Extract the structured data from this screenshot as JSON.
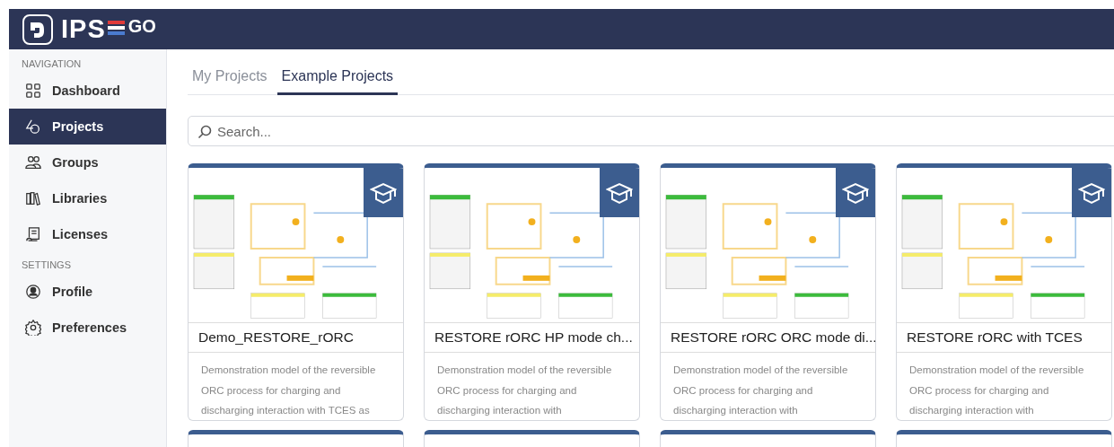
{
  "app": {
    "logo_text": "IPS",
    "logo_suffix": "GO"
  },
  "sidebar": {
    "sections": [
      {
        "heading": "NAVIGATION",
        "items": [
          {
            "label": "Dashboard",
            "kind": "grid",
            "selected": false
          },
          {
            "label": "Projects",
            "kind": "shapes",
            "selected": true
          },
          {
            "label": "Groups",
            "kind": "users",
            "selected": false
          },
          {
            "label": "Libraries",
            "kind": "books",
            "selected": false
          },
          {
            "label": "Licenses",
            "kind": "scroll",
            "selected": false
          }
        ]
      },
      {
        "heading": "SETTINGS",
        "items": [
          {
            "label": "Profile",
            "kind": "profile",
            "selected": false
          },
          {
            "label": "Preferences",
            "kind": "gear",
            "selected": false
          }
        ]
      }
    ]
  },
  "tabs": [
    {
      "label": "My Projects",
      "selected": false
    },
    {
      "label": "Example Projects",
      "selected": true
    }
  ],
  "search": {
    "placeholder": "Search..."
  },
  "projects": [
    {
      "title": "Demo_RESTORE_rORC",
      "description": "Demonstration model of the reversible ORC process for charging and discharging interaction with TCES as"
    },
    {
      "title": "RESTORE rORC HP mode ch...",
      "description": "Demonstration model of the reversible ORC process for charging and discharging interaction with"
    },
    {
      "title": "RESTORE rORC ORC mode di...",
      "description": "Demonstration model of the reversible ORC process for charging and discharging interaction with"
    },
    {
      "title": "RESTORE rORC with TCES",
      "description": "Demonstration model of the reversible ORC process for charging and discharging interaction with"
    }
  ]
}
